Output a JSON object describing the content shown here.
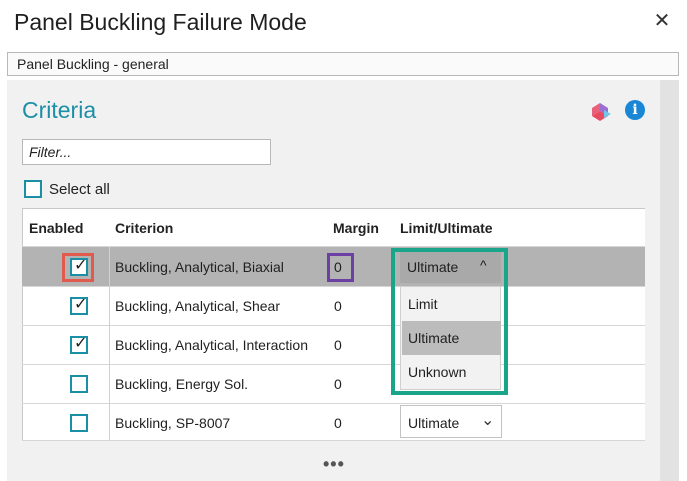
{
  "window": {
    "title": "Panel Buckling Failure Mode",
    "subtitle": "Panel Buckling - general",
    "close_glyph": "✕"
  },
  "section": {
    "title": "Criteria",
    "info_glyph": "i"
  },
  "filter": {
    "placeholder": "Filter...",
    "value": ""
  },
  "select_all": {
    "label": "Select all",
    "checked": false
  },
  "table": {
    "headers": [
      "Enabled",
      "Criterion",
      "Margin",
      "Limit/Ultimate"
    ],
    "rows": [
      {
        "enabled": true,
        "criterion": "Buckling, Analytical, Biaxial",
        "margin": "0",
        "limit_ultimate": "Ultimate"
      },
      {
        "enabled": true,
        "criterion": "Buckling, Analytical, Shear",
        "margin": "0",
        "limit_ultimate": ""
      },
      {
        "enabled": true,
        "criterion": "Buckling, Analytical, Interaction",
        "margin": "0",
        "limit_ultimate": ""
      },
      {
        "enabled": false,
        "criterion": "Buckling, Energy Sol.",
        "margin": "0",
        "limit_ultimate": ""
      },
      {
        "enabled": false,
        "criterion": "Buckling, SP-8007",
        "margin": "0",
        "limit_ultimate": "Ultimate"
      }
    ]
  },
  "dropdown": {
    "selected": "Ultimate",
    "options": [
      "Limit",
      "Ultimate",
      "Unknown"
    ]
  },
  "glyphs": {
    "check": "✓",
    "chevron_up": "^",
    "chevron_down": "⌄",
    "more": "•••"
  },
  "colors": {
    "accent": "#1b8fa6",
    "highlight_red": "#e05a4e",
    "highlight_purple": "#6c3fa4",
    "highlight_teal": "#1aa58b",
    "info_blue": "#1a87d6"
  }
}
